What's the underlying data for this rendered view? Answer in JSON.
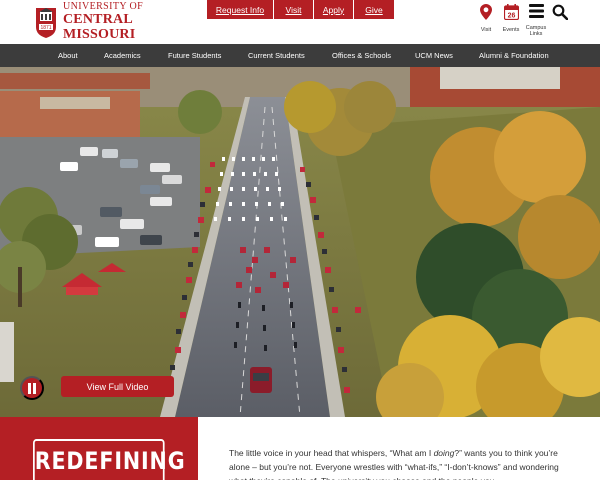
{
  "header": {
    "logo": {
      "line1": "UNIVERSITY OF",
      "line2": "CENTRAL",
      "line3": "MISSOURI",
      "seal_year": "1871"
    },
    "quick_links": [
      "Request Info",
      "Visit",
      "Apply",
      "Give"
    ],
    "utility": {
      "visit_label": "Visit",
      "events_label": "Events",
      "events_day": "26",
      "campus_links_label_1": "Campus",
      "campus_links_label_2": "Links",
      "search_icon": "search-icon"
    }
  },
  "nav": {
    "items": [
      "About",
      "Academics",
      "Future Students",
      "Current Students",
      "Offices & Schools",
      "UCM News",
      "Alumni & Foundation"
    ]
  },
  "hero": {
    "video_button_label": "View Full Video",
    "pause_icon": "pause-icon"
  },
  "intro": {
    "heading": "REDEFINING",
    "text_before": "The little voice in your head that whispers, “What am I ",
    "text_em": "doing",
    "text_after": "?” wants you to think you’re alone – but you’re not.  Everyone wrestles with “what-ifs,” “I-don’t-knows” and wondering what they’re capable of. The university you choose and the people you"
  },
  "colors": {
    "brand_red": "#b41f24",
    "nav_bg": "#3c3c3c"
  }
}
